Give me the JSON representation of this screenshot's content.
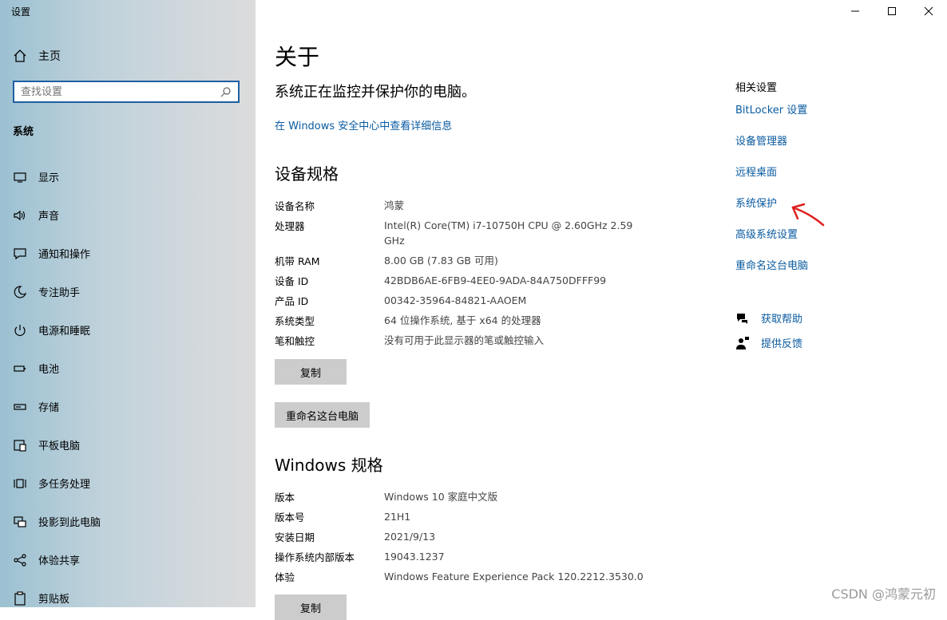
{
  "app": {
    "title": "设置"
  },
  "sidebar": {
    "home_label": "主页",
    "search_placeholder": "查找设置",
    "section_title": "系统",
    "items": [
      {
        "label": "显示",
        "icon": "monitor-icon"
      },
      {
        "label": "声音",
        "icon": "speaker-icon"
      },
      {
        "label": "通知和操作",
        "icon": "notification-icon"
      },
      {
        "label": "专注助手",
        "icon": "moon-icon"
      },
      {
        "label": "电源和睡眠",
        "icon": "power-icon"
      },
      {
        "label": "电池",
        "icon": "battery-icon"
      },
      {
        "label": "存储",
        "icon": "storage-icon"
      },
      {
        "label": "平板电脑",
        "icon": "tablet-icon"
      },
      {
        "label": "多任务处理",
        "icon": "multitask-icon"
      },
      {
        "label": "投影到此电脑",
        "icon": "project-icon"
      },
      {
        "label": "体验共享",
        "icon": "share-icon"
      },
      {
        "label": "剪贴板",
        "icon": "clipboard-icon"
      }
    ]
  },
  "main": {
    "title": "关于",
    "status": "系统正在监控并保护你的电脑。",
    "security_link": "在 Windows 安全中心中查看详细信息",
    "device_specs": {
      "heading": "设备规格",
      "rows": [
        {
          "label": "设备名称",
          "value": "鸿蒙"
        },
        {
          "label": "处理器",
          "value": "Intel(R) Core(TM) i7-10750H CPU @ 2.60GHz   2.59 GHz"
        },
        {
          "label": "机带 RAM",
          "value": "8.00 GB (7.83 GB 可用)"
        },
        {
          "label": "设备 ID",
          "value": "42BDB6AE-6FB9-4EE0-9ADA-84A750DFFF99"
        },
        {
          "label": "产品 ID",
          "value": "00342-35964-84821-AAOEM"
        },
        {
          "label": "系统类型",
          "value": "64 位操作系统, 基于 x64 的处理器"
        },
        {
          "label": "笔和触控",
          "value": "没有可用于此显示器的笔或触控输入"
        }
      ],
      "copy_button": "复制",
      "rename_button": "重命名这台电脑"
    },
    "windows_specs": {
      "heading": "Windows 规格",
      "rows": [
        {
          "label": "版本",
          "value": "Windows 10 家庭中文版"
        },
        {
          "label": "版本号",
          "value": "21H1"
        },
        {
          "label": "安装日期",
          "value": "2021/9/13"
        },
        {
          "label": "操作系统内部版本",
          "value": "19043.1237"
        },
        {
          "label": "体验",
          "value": "Windows Feature Experience Pack 120.2212.3530.0"
        }
      ],
      "copy_button": "复制"
    }
  },
  "related": {
    "title": "相关设置",
    "links": [
      "BitLocker 设置",
      "设备管理器",
      "远程桌面",
      "系统保护",
      "高级系统设置",
      "重命名这台电脑"
    ],
    "help": "获取帮助",
    "feedback": "提供反馈"
  },
  "watermark": "CSDN @鸿蒙元初",
  "colors": {
    "link": "#0a5ba0",
    "accent": "#1f5fa0",
    "annotation": "#e02020"
  }
}
